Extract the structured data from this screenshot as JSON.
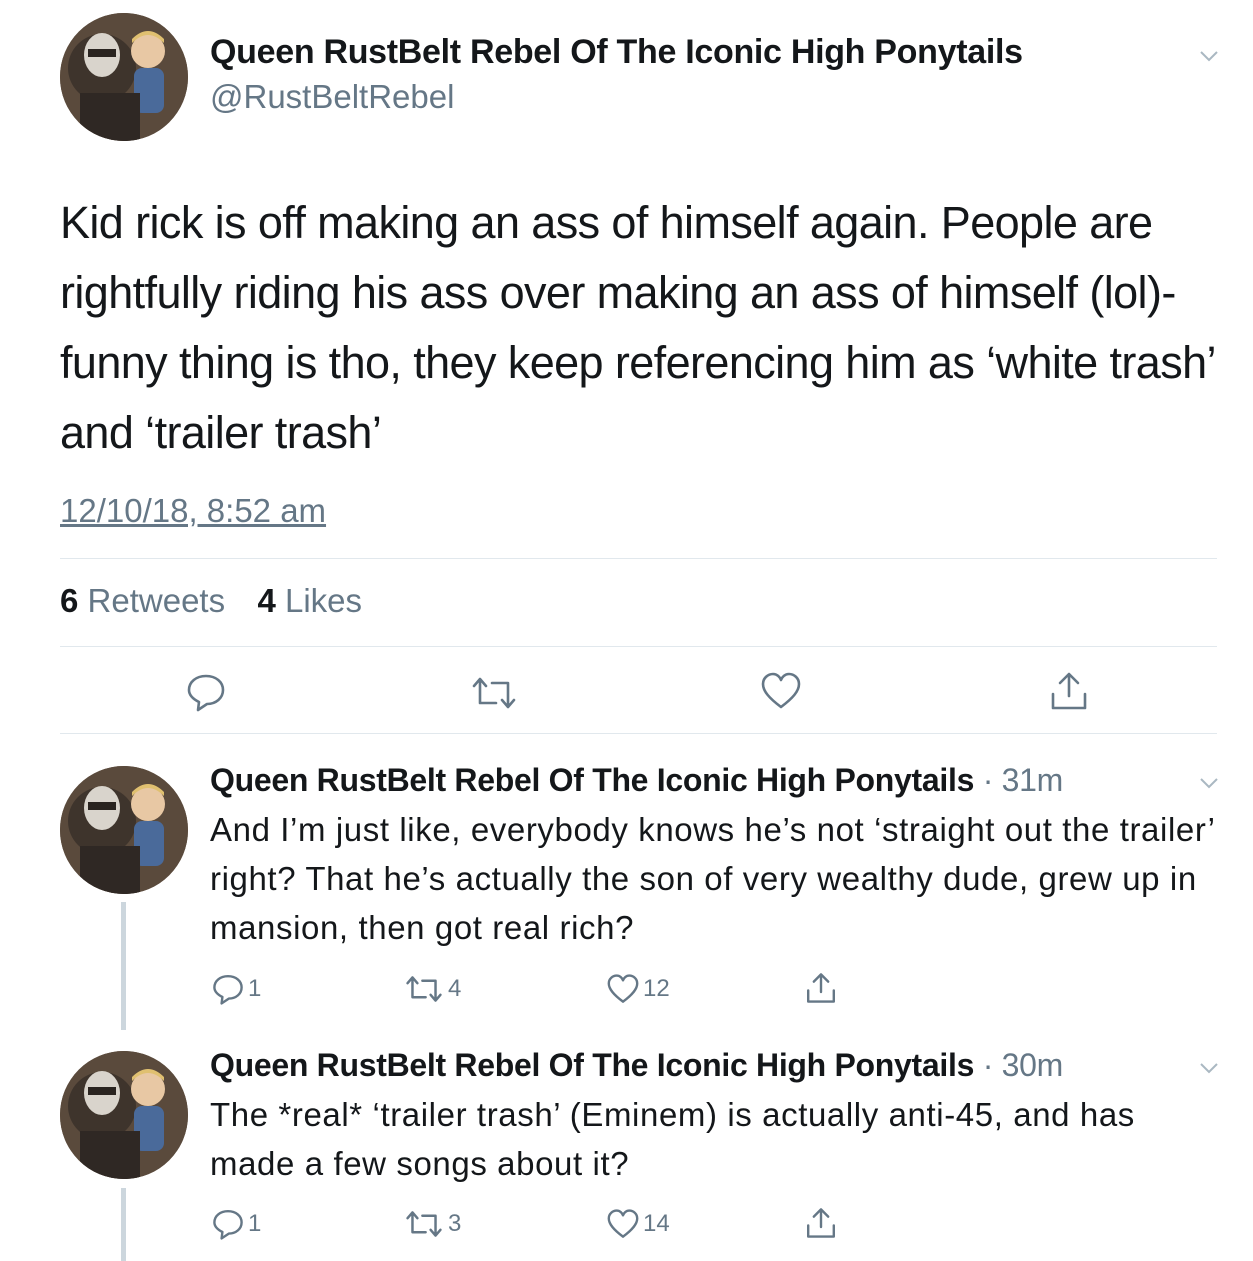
{
  "main_tweet": {
    "name": "Queen RustBelt Rebel Of The Iconic High Ponytails",
    "handle": "@RustBeltRebel",
    "text": "Kid rick is off making an ass of himself again. People are rightfully riding his ass over making an ass of himself (lol)- funny thing is tho, they keep referencing him as ‘white trash’ and ‘trailer trash’",
    "timestamp": "12/10/18, 8:52 am",
    "retweets_count": "6",
    "retweets_label": "Retweets",
    "likes_count": "4",
    "likes_label": "Likes"
  },
  "replies": [
    {
      "name": "Queen RustBelt Rebel Of The Iconic High Ponytails",
      "time": "· 31m",
      "text": "And I’m just like, everybody knows he’s not ‘straight out the trailer’ right? That he’s actually the son of very wealthy dude, grew up in mansion, then got real rich?",
      "replies": "1",
      "retweets": "4",
      "likes": "12"
    },
    {
      "name": "Queen RustBelt Rebel Of The Iconic High Ponytails",
      "time": "· 30m",
      "text": "The *real* ‘trailer trash’ (Eminem) is actually anti-45, and has made a few songs about it?",
      "replies": "1",
      "retweets": "3",
      "likes": "14"
    }
  ],
  "icons": {
    "reply": "reply-icon",
    "retweet": "retweet-icon",
    "like": "heart-icon",
    "share": "share-icon",
    "caret": "chevron-down-icon"
  },
  "colors": {
    "text": "#14171a",
    "secondary": "#657786",
    "divider": "#e1e8ed",
    "thread_line": "#ccd6dd"
  }
}
